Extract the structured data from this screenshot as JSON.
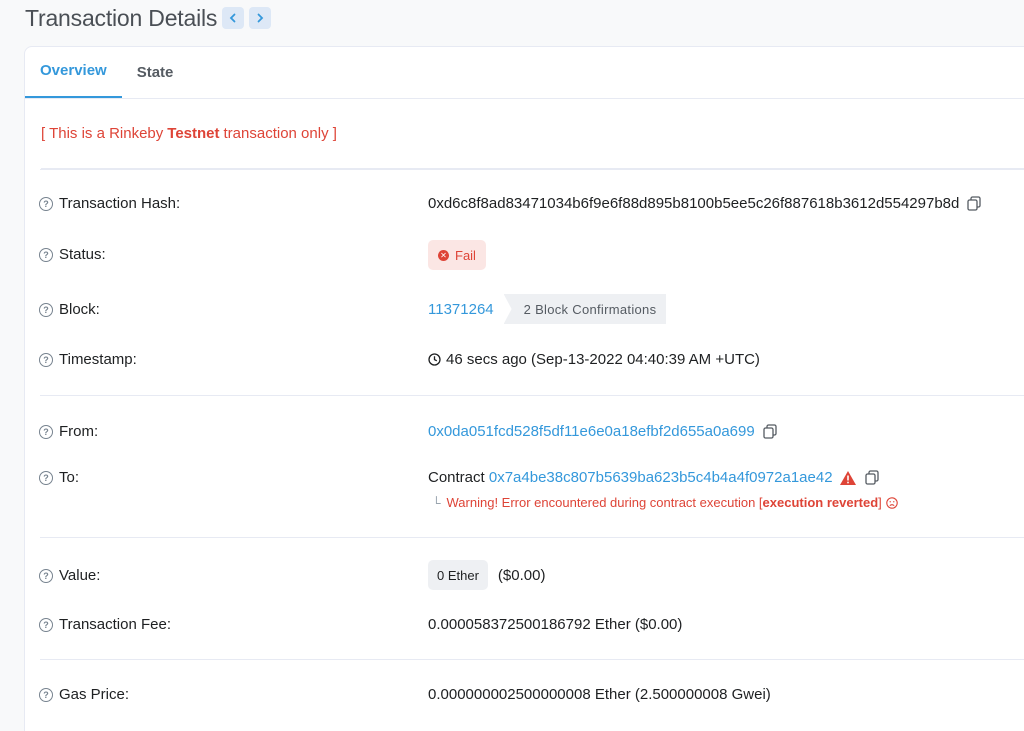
{
  "header": {
    "title": "Transaction Details",
    "prev_icon": "chevron-left-icon",
    "next_icon": "chevron-right-icon"
  },
  "tabs": [
    {
      "label": "Overview",
      "active": true
    },
    {
      "label": "State",
      "active": false
    }
  ],
  "testnet_notice": {
    "prefix": "[ This is a Rinkeby",
    "bold": "Testnet",
    "suffix": "transaction only ]"
  },
  "fields": {
    "tx_hash": {
      "label": "Transaction Hash:",
      "value": "0xd6c8f8ad83471034b6f9e6f88d895b8100b5ee5c26f887618b3612d554297b8d"
    },
    "status": {
      "label": "Status:",
      "value": "Fail"
    },
    "block": {
      "label": "Block:",
      "value": "11371264",
      "confirmations": "2 Block Confirmations"
    },
    "timestamp": {
      "label": "Timestamp:",
      "value": "46 secs ago (Sep-13-2022 04:40:39 AM +UTC)"
    },
    "from": {
      "label": "From:",
      "value": "0x0da051fcd528f5df11e6e0a18efbf2d655a0a699"
    },
    "to": {
      "label": "To:",
      "prefix": "Contract",
      "value": "0x7a4be38c807b5639ba623b5c4b4a4f0972a1ae42",
      "warning_prefix": "Warning! Error encountered during contract execution [",
      "warning_bold": "execution reverted",
      "warning_suffix": "]"
    },
    "value": {
      "label": "Value:",
      "badge": "0 Ether",
      "usd": "($0.00)"
    },
    "fee": {
      "label": "Transaction Fee:",
      "value": "0.000058372500186792 Ether ($0.00)"
    },
    "gas_price": {
      "label": "Gas Price:",
      "value": "0.000000002500000008 Ether (2.500000008 Gwei)"
    }
  },
  "colors": {
    "accent": "#3498db",
    "danger": "#de4437"
  }
}
